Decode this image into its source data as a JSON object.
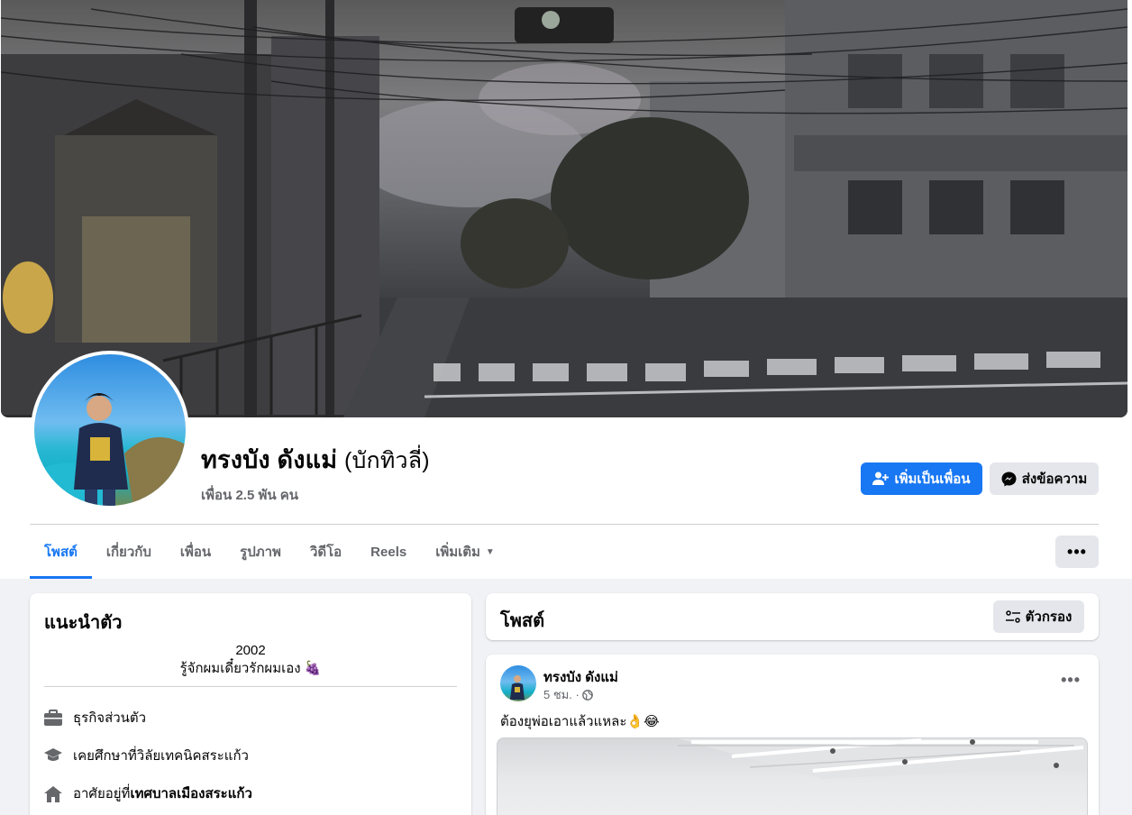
{
  "profile": {
    "name": "ทรงบัง ดังแม่",
    "alt_name": "(บักทิวลี่)",
    "friends": "เพื่อน 2.5 พัน คน",
    "add_friend_label": "เพิ่มเป็นเพื่อน",
    "message_label": "ส่งข้อความ"
  },
  "tabs": [
    {
      "label": "โพสต์",
      "active": true
    },
    {
      "label": "เกี่ยวกับ"
    },
    {
      "label": "เพื่อน"
    },
    {
      "label": "รูปภาพ"
    },
    {
      "label": "วิดีโอ"
    },
    {
      "label": "Reels"
    },
    {
      "label": "เพิ่มเติม"
    }
  ],
  "more_options": "•••",
  "intro": {
    "title": "แนะนำตัว",
    "bio_line1": "2002",
    "bio_line2": "รู้จักผมเดี๋ยวรักผมเอง 🍇",
    "work": "ธุรกิจส่วนตัว",
    "education_prefix": "เคยศึกษาที่ ",
    "education": "วิลัยเทคนิคสระแก้ว",
    "lives_prefix": "อาศัยอยู่ที่ ",
    "lives": "เทศบาลเมืองสระแก้ว"
  },
  "posts": {
    "title": "โพสต์",
    "filter_label": "ตัวกรอง"
  },
  "post": {
    "author": "ทรงบัง ดังแม่",
    "time": "5 ชม. ·",
    "text": "ต้องยุพ่อเอาแล้วแหละ👌😂",
    "options": "•••"
  },
  "colors": {
    "accent": "#1877f2",
    "page_bg": "#f0f2f5",
    "button_gray": "#e4e6eb",
    "secondary_text": "#65676b"
  }
}
